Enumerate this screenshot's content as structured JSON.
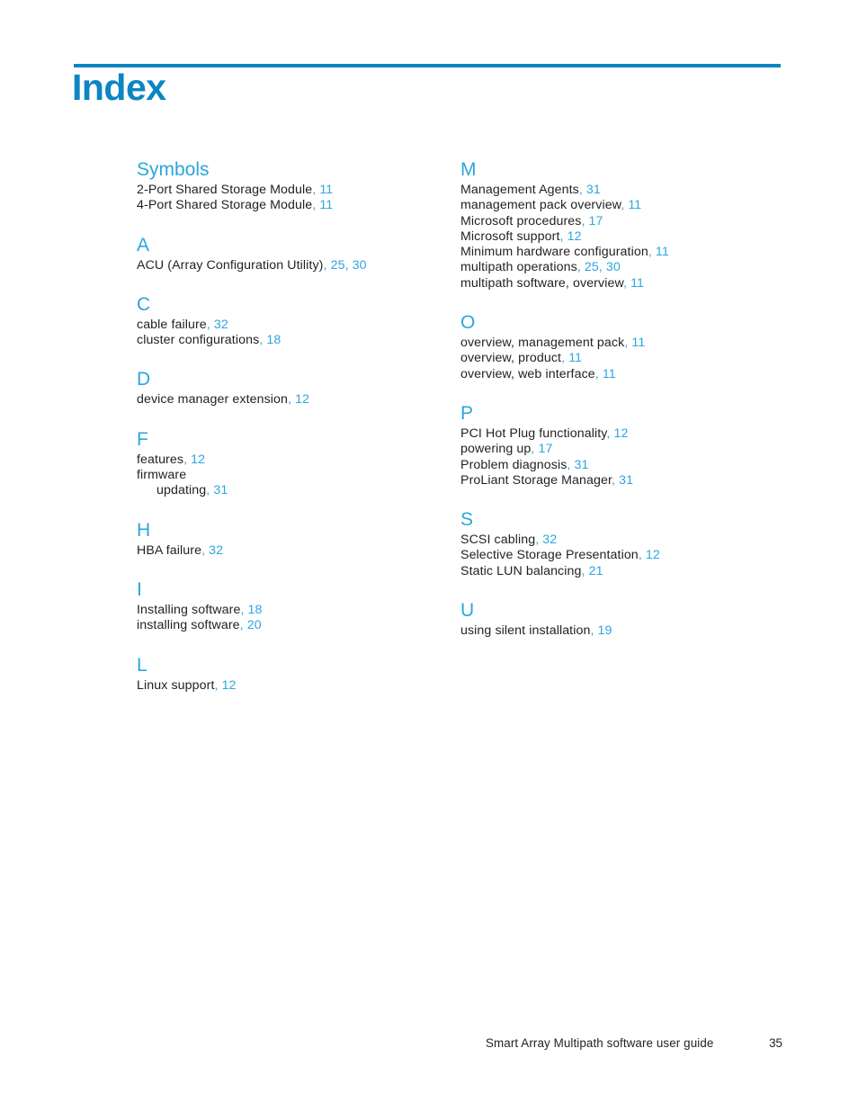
{
  "header": {
    "title": "Index",
    "rule_color": "#0b86c3"
  },
  "colors": {
    "accent_blue": "#0b86c3",
    "link_blue": "#2ba6de",
    "body_text": "#231f20"
  },
  "columns": {
    "left": [
      {
        "letter": "Symbols",
        "entries": [
          {
            "text": "2-Port Shared Storage Module",
            "pages": ", 11",
            "sub": false
          },
          {
            "text": "4-Port Shared Storage Module",
            "pages": ", 11",
            "sub": false
          }
        ]
      },
      {
        "letter": "A",
        "entries": [
          {
            "text": "ACU (Array Configuration Utility)",
            "pages": ", 25, 30",
            "sub": false
          }
        ]
      },
      {
        "letter": "C",
        "entries": [
          {
            "text": "cable failure",
            "pages": ", 32",
            "sub": false
          },
          {
            "text": "cluster configurations",
            "pages": ", 18",
            "sub": false
          }
        ]
      },
      {
        "letter": "D",
        "entries": [
          {
            "text": "device manager extension",
            "pages": ", 12",
            "sub": false
          }
        ]
      },
      {
        "letter": "F",
        "entries": [
          {
            "text": "features",
            "pages": ", 12",
            "sub": false
          },
          {
            "text": "firmware",
            "pages": "",
            "sub": false
          },
          {
            "text": "updating",
            "pages": ", 31",
            "sub": true
          }
        ]
      },
      {
        "letter": "H",
        "entries": [
          {
            "text": "HBA failure",
            "pages": ", 32",
            "sub": false
          }
        ]
      },
      {
        "letter": "I",
        "entries": [
          {
            "text": "Installing software",
            "pages": ", 18",
            "sub": false
          },
          {
            "text": "installing software",
            "pages": ", 20",
            "sub": false
          }
        ]
      },
      {
        "letter": "L",
        "entries": [
          {
            "text": "Linux support",
            "pages": ", 12",
            "sub": false
          }
        ]
      }
    ],
    "right": [
      {
        "letter": "M",
        "entries": [
          {
            "text": "Management Agents",
            "pages": ", 31",
            "sub": false
          },
          {
            "text": "management pack overview",
            "pages": ", 11",
            "sub": false
          },
          {
            "text": "Microsoft procedures",
            "pages": ", 17",
            "sub": false
          },
          {
            "text": "Microsoft support",
            "pages": ", 12",
            "sub": false
          },
          {
            "text": "Minimum hardware configuration",
            "pages": ", 11",
            "sub": false
          },
          {
            "text": "multipath operations",
            "pages": ", 25, 30",
            "sub": false
          },
          {
            "text": "multipath software, overview",
            "pages": ", 11",
            "sub": false
          }
        ]
      },
      {
        "letter": "O",
        "entries": [
          {
            "text": "overview, management pack",
            "pages": ", 11",
            "sub": false
          },
          {
            "text": "overview, product",
            "pages": ", 11",
            "sub": false
          },
          {
            "text": "overview, web interface",
            "pages": ", 11",
            "sub": false
          }
        ]
      },
      {
        "letter": "P",
        "entries": [
          {
            "text": "PCI Hot Plug functionality",
            "pages": ", 12",
            "sub": false
          },
          {
            "text": "powering up",
            "pages": ", 17",
            "sub": false
          },
          {
            "text": "Problem diagnosis",
            "pages": ", 31",
            "sub": false
          },
          {
            "text": "ProLiant Storage Manager",
            "pages": ", 31",
            "sub": false
          }
        ]
      },
      {
        "letter": "S",
        "entries": [
          {
            "text": "SCSI cabling",
            "pages": ", 32",
            "sub": false
          },
          {
            "text": "Selective Storage Presentation",
            "pages": ", 12",
            "sub": false
          },
          {
            "text": "Static LUN balancing",
            "pages": ", 21",
            "sub": false
          }
        ]
      },
      {
        "letter": "U",
        "entries": [
          {
            "text": "using silent installation",
            "pages": ", 19",
            "sub": false
          }
        ]
      }
    ]
  },
  "footer": {
    "title": "Smart Array Multipath software user guide",
    "page_number": "35"
  }
}
